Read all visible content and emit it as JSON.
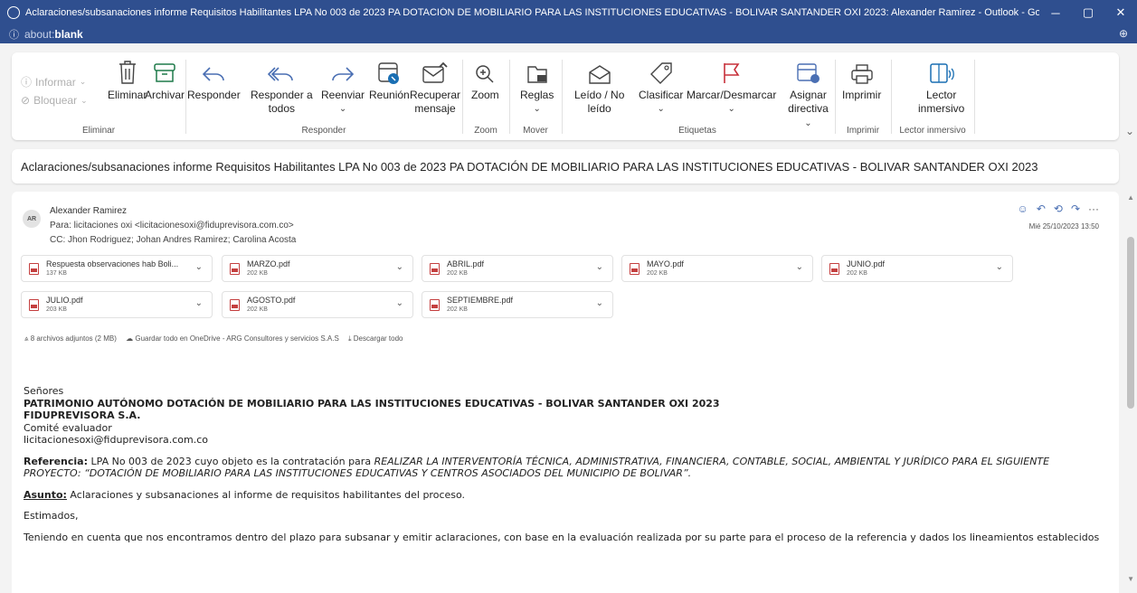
{
  "window": {
    "title": "Aclaraciones/subsanaciones informe Requisitos Habilitantes LPA No 003 de 2023 PA DOTACIÓN DE MOBILIARIO PARA LAS INSTITUCIONES EDUCATIVAS - BOLIVAR SANTANDER OXI 2023: Alexander Ramirez - Outlook - Google Chrome",
    "minimize": "─",
    "restore": "▢",
    "close": "✕"
  },
  "address": {
    "scheme": "about:",
    "host": "blank",
    "info_icon": "ⓘ",
    "zoom_icon": "⊕"
  },
  "ribbon": {
    "eliminar": {
      "informar": "Informar",
      "bloquear": "Bloquear",
      "eliminar": "Eliminar",
      "archivar": "Archivar",
      "label": "Eliminar"
    },
    "responder": {
      "responder": "Responder",
      "responder_todos_1": "Responder a",
      "responder_todos_2": "todos",
      "reenviar": "Reenviar",
      "reunion": "Reunión",
      "recuperar_1": "Recuperar",
      "recuperar_2": "mensaje",
      "label": "Responder"
    },
    "zoom": {
      "zoom": "Zoom",
      "label": "Zoom"
    },
    "mover": {
      "reglas": "Reglas",
      "label": "Mover"
    },
    "etiquetas": {
      "leido_1": "Leído / No",
      "leido_2": "leído",
      "clasificar": "Clasificar",
      "marcar": "Marcar/Desmarcar",
      "asignar_1": "Asignar",
      "asignar_2": "directiva",
      "label": "Etiquetas"
    },
    "imprimir": {
      "imprimir": "Imprimir",
      "label": "Imprimir"
    },
    "lector": {
      "lector_1": "Lector",
      "lector_2": "inmersivo",
      "label": "Lector inmersivo"
    },
    "caret": "⌄",
    "collapse": "⌄"
  },
  "subject": "Aclaraciones/subsanaciones informe Requisitos Habilitantes LPA No 003 de 2023 PA DOTACIÓN DE MOBILIARIO PARA LAS INSTITUCIONES EDUCATIVAS - BOLIVAR SANTANDER OXI 2023",
  "message": {
    "avatar": "AR",
    "sender": "Alexander Ramirez",
    "to": "Para: licitaciones oxi <licitacionesoxi@fiduprevisora.com.co>",
    "cc": "CC: Jhon Rodriguez; Johan Andres Ramirez; Carolina Acosta",
    "date": "Mié 25/10/2023 13:50",
    "actions": {
      "emoji": "☺",
      "reply": "↶",
      "reply_all": "⟲",
      "forward": "↷",
      "more": "···"
    },
    "attachments": [
      {
        "name": "Respuesta observaciones hab Boli...",
        "size": "137 KB"
      },
      {
        "name": "MARZO.pdf",
        "size": "202 KB"
      },
      {
        "name": "ABRIL.pdf",
        "size": "202 KB"
      },
      {
        "name": "MAYO.pdf",
        "size": "202 KB"
      },
      {
        "name": "JUNIO.pdf",
        "size": "202 KB"
      },
      {
        "name": "JULIO.pdf",
        "size": "203 KB"
      },
      {
        "name": "AGOSTO.pdf",
        "size": "202 KB"
      },
      {
        "name": "SEPTIEMBRE.pdf",
        "size": "202 KB"
      }
    ],
    "attachment_chevron": "⌄",
    "attachment_bar": {
      "count": "⩓ 8 archivos adjuntos (2 MB)",
      "onedrive": "☁ Guardar todo en OneDrive - ARG Consultores y servicios S.A.S",
      "download": "⤓ Descargar todo"
    }
  },
  "body": {
    "senores": "Señores",
    "patrimonio": "PATRIMONIO AUTÓNOMO DOTACIÓN DE MOBILIARIO PARA LAS INSTITUCIONES EDUCATIVAS - BOLIVAR SANTANDER OXI 2023",
    "fidu": "FIDUPREVISORA S.A.",
    "comite": "Comité evaluador",
    "email": "licitacionesoxi@fiduprevisora.com.co",
    "ref_label": "Referencia:",
    "ref_text": " LPA No 003 de 2023 cuyo objeto es la contratación para ",
    "ref_italic": "REALIZAR LA INTERVENTORÍA TÉCNICA, ADMINISTRATIVA, FINANCIERA, CONTABLE, SOCIAL, AMBIENTAL Y JURÍDICO PARA EL SIGUIENTE PROYECTO: “DOTACIÓN DE MOBILIARIO PARA LAS INSTITUCIONES EDUCATIVAS Y CENTROS ASOCIADOS DEL MUNICIPIO DE BOLIVAR”.",
    "asunto_label": "Asunto:",
    "asunto_text": " Aclaraciones y subsanaciones al informe de requisitos habilitantes del proceso.",
    "estimados": "Estimados,",
    "parrafo": "Teniendo en cuenta que nos encontramos dentro del plazo para subsanar y emitir aclaraciones, con base en la evaluación realizada por su parte para el proceso de la referencia y dados los lineamientos establecidos"
  }
}
